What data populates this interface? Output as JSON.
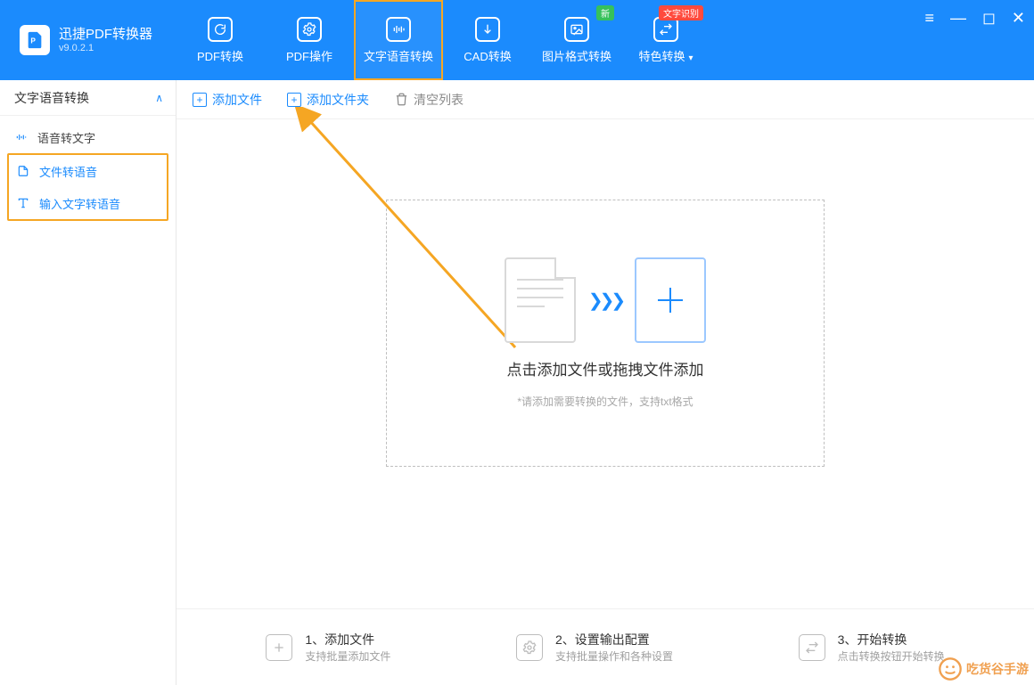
{
  "brand": {
    "title": "迅捷PDF转换器",
    "version": "v9.0.2.1"
  },
  "tabs": [
    {
      "label": "PDF转换"
    },
    {
      "label": "PDF操作"
    },
    {
      "label": "文字语音转换",
      "active": true
    },
    {
      "label": "CAD转换"
    },
    {
      "label": "图片格式转换",
      "badge": "新",
      "badgeClass": "green"
    },
    {
      "label": "特色转换",
      "badge": "文字识别",
      "badgeClass": "red",
      "dropdown": true
    }
  ],
  "sidebar": {
    "header": "文字语音转换",
    "items": [
      {
        "label": "语音转文字",
        "blue": false
      },
      {
        "label": "文件转语音",
        "blue": true,
        "groupStart": true
      },
      {
        "label": "输入文字转语音",
        "blue": true,
        "groupEnd": true
      }
    ]
  },
  "toolbar": {
    "add_file": "添加文件",
    "add_folder": "添加文件夹",
    "clear": "清空列表"
  },
  "dropzone": {
    "title": "点击添加文件或拖拽文件添加",
    "sub": "*请添加需要转换的文件，支持txt格式"
  },
  "steps": [
    {
      "title": "1、添加文件",
      "sub": "支持批量添加文件"
    },
    {
      "title": "2、设置输出配置",
      "sub": "支持批量操作和各种设置"
    },
    {
      "title": "3、开始转换",
      "sub": "点击转换按钮开始转换"
    }
  ],
  "watermark": "吃货谷手游"
}
